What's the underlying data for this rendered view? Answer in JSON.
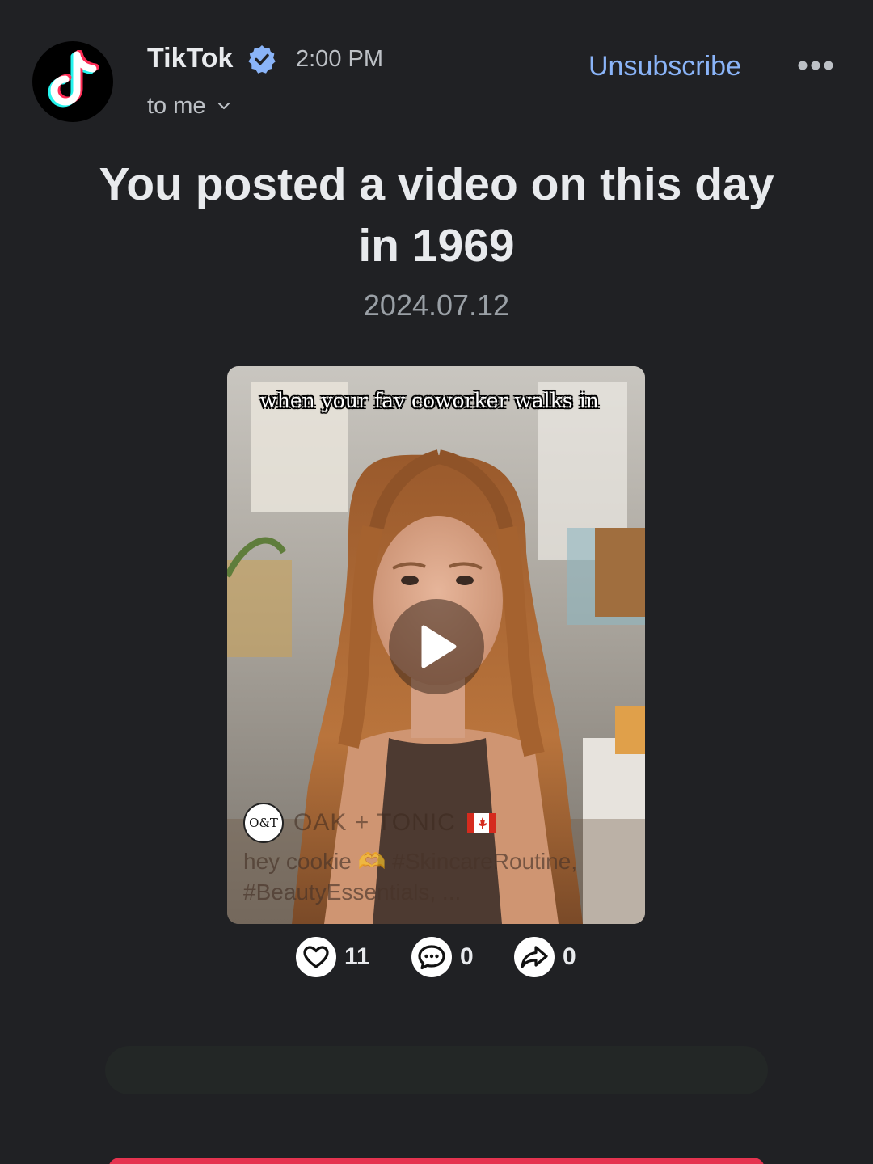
{
  "sender": {
    "name": "TikTok",
    "time": "2:00 PM",
    "recipient": "to me"
  },
  "actions": {
    "unsubscribe": "Unsubscribe"
  },
  "email": {
    "headline": "You posted a video on this day in 1969",
    "date": "2024.07.12"
  },
  "video": {
    "caption": "when your fav coworker walks in",
    "creator_avatar_text": "O&T",
    "creator_name": "OAK + TONIC",
    "description": "hey cookie 🫶 #SkincareRoutine, #BeautyEssentials, ..."
  },
  "stats": {
    "likes": "11",
    "comments": "0",
    "shares": "0"
  },
  "colors": {
    "background": "#202124",
    "link": "#8ab4f8",
    "accent": "#e5334f"
  },
  "icons": [
    "tiktok-logo-icon",
    "verified-badge-icon",
    "chevron-down-icon",
    "more-options-icon",
    "play-icon",
    "canada-flag-icon",
    "heart-icon",
    "comment-icon",
    "share-icon"
  ]
}
